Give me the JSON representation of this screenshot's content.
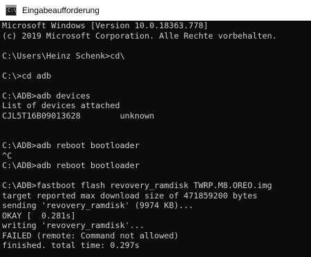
{
  "window": {
    "title": "Eingabeaufforderung",
    "icon": "command-prompt-icon",
    "icon_glyph": "C:\\",
    "background_color": "#0c0c0c",
    "text_color": "#cccccc"
  },
  "console": {
    "lines": [
      "Microsoft Windows [Version 10.0.18363.778]",
      "(c) 2019 Microsoft Corporation. Alle Rechte vorbehalten.",
      "",
      "C:\\Users\\Heinz Schenk>cd\\",
      "",
      "C:\\>cd adb",
      "",
      "C:\\ADB>adb devices",
      "List of devices attached",
      "CJL5T16B09013628        unknown",
      "",
      "",
      "C:\\ADB>adb reboot bootloader",
      "^C",
      "C:\\ADB>adb reboot bootloader",
      "",
      "C:\\ADB>fastboot flash revovery_ramdisk TWRP.M8.OREO.img",
      "target reported max download size of 471859200 bytes",
      "sending 'revovery_ramdisk' (9974 KB)...",
      "OKAY [  0.281s]",
      "writing 'revovery_ramdisk'...",
      "FAILED (remote: Command not allowed)",
      "finished. total time: 0.297s"
    ]
  }
}
